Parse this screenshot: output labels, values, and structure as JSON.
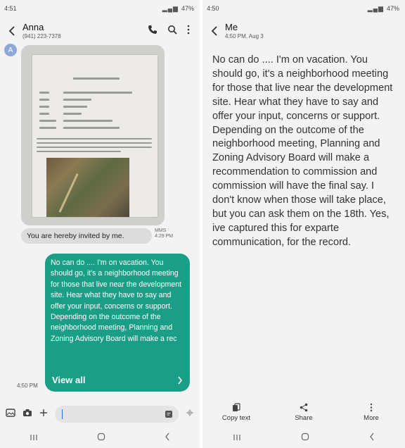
{
  "left": {
    "status": {
      "time": "4:51",
      "battery": "47%"
    },
    "header": {
      "name": "Anna",
      "phone": "(941) 223-7378"
    },
    "avatar_letter": "A",
    "received": {
      "caption": "You are hereby invited by me.",
      "tag": "MMS",
      "time": "4:29 PM"
    },
    "sent": {
      "text": "No can do .... I'm on vacation. You should go, it's a neighborhood meeting for those that live near the development site.  Hear what they have to say and offer your input, concerns or support.   Depending on the outcome of the neighborhood meeting, Planning and Zoning Advisory Board will make a rec",
      "view_all": "View all",
      "time": "4:50 PM"
    }
  },
  "right": {
    "status": {
      "time": "4:50",
      "battery": "47%"
    },
    "header": {
      "name": "Me",
      "sub": "4:50 PM, Aug 3"
    },
    "message": "No can do .... I'm on vacation.  You should go, it's a neighborhood meeting for those that live near the development site.  Hear what they have to say and offer your input, concerns or support.   Depending on the outcome of the neighborhood meeting, Planning and Zoning Advisory Board will make a recommendation to commission and commission will have the final say.   I don't know when those will take place, but you can ask them on the 18th.  Yes, ive captured this for exparte communication, for the record.",
    "actions": {
      "copy": "Copy text",
      "share": "Share",
      "more": "More"
    }
  }
}
